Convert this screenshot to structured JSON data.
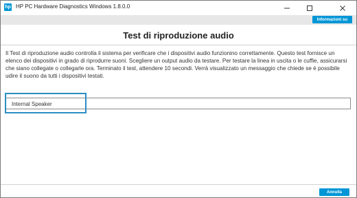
{
  "window": {
    "title": "HP PC Hardware Diagnostics Windows 1.8.0.0",
    "icon": "hp-logo-icon",
    "icon_text": "hp"
  },
  "header": {
    "info_button": "Informazioni su"
  },
  "main": {
    "title": "Test di riproduzione audio",
    "description": "Il Test di riproduzione audio controlla il sistema per verificare che i dispositivi audio funzionino correttamente. Questo test fornisce un elenco dei dispositivi in grado di riprodurre suoni. Scegliere un output audio da testare. Per testare la linea in uscita o le cuffie, assicurarsi che siano collegate o collegarle ora. Terminato il test, attendere 10 secondi. Verrà visualizzato un messaggio che chiede se è possibile udire il suono da tutti i dispositivi testati.",
    "devices": [
      "Internal Speaker"
    ]
  },
  "footer": {
    "cancel_button": "Annulla"
  },
  "colors": {
    "accent": "#0096d6",
    "highlight": "#2a8dc3"
  }
}
